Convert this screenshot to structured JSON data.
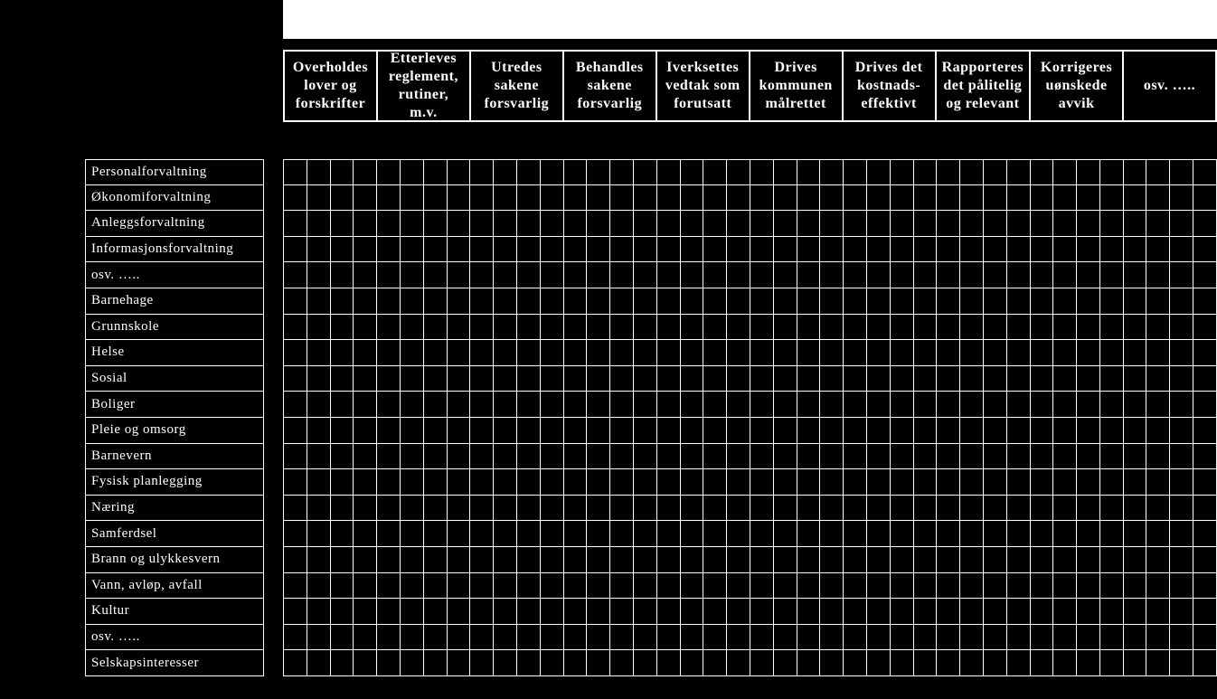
{
  "columnHeaders": [
    "Overholdes lover og forskrifter",
    "Etterleves reglement, rutiner, m.v.",
    "Utredes sakene forsvarlig",
    "Behandles sakene forsvarlig",
    "Iverksettes vedtak som forutsatt",
    "Drives kommunen målrettet",
    "Drives det kostnads- effektivt",
    "Rapporteres det pålitelig og relevant",
    "Korrigeres uønskede avvik",
    "osv. ….."
  ],
  "rowHeaders": [
    "Personalforvaltning",
    "Økonomiforvaltning",
    "Anleggsforvaltning",
    "Informasjonsforvaltning",
    "osv. …..",
    "Barnehage",
    "Grunnskole",
    "Helse",
    "Sosial",
    "Boliger",
    "Pleie og omsorg",
    "Barnevern",
    "Fysisk planlegging",
    "Næring",
    "Samferdsel",
    "Brann og ulykkesvern",
    "Vann, avløp, avfall",
    "Kultur",
    "osv. …..",
    "Selskapsinteresser"
  ],
  "gridSubColsPerHeader": 4,
  "gridCells": {}
}
